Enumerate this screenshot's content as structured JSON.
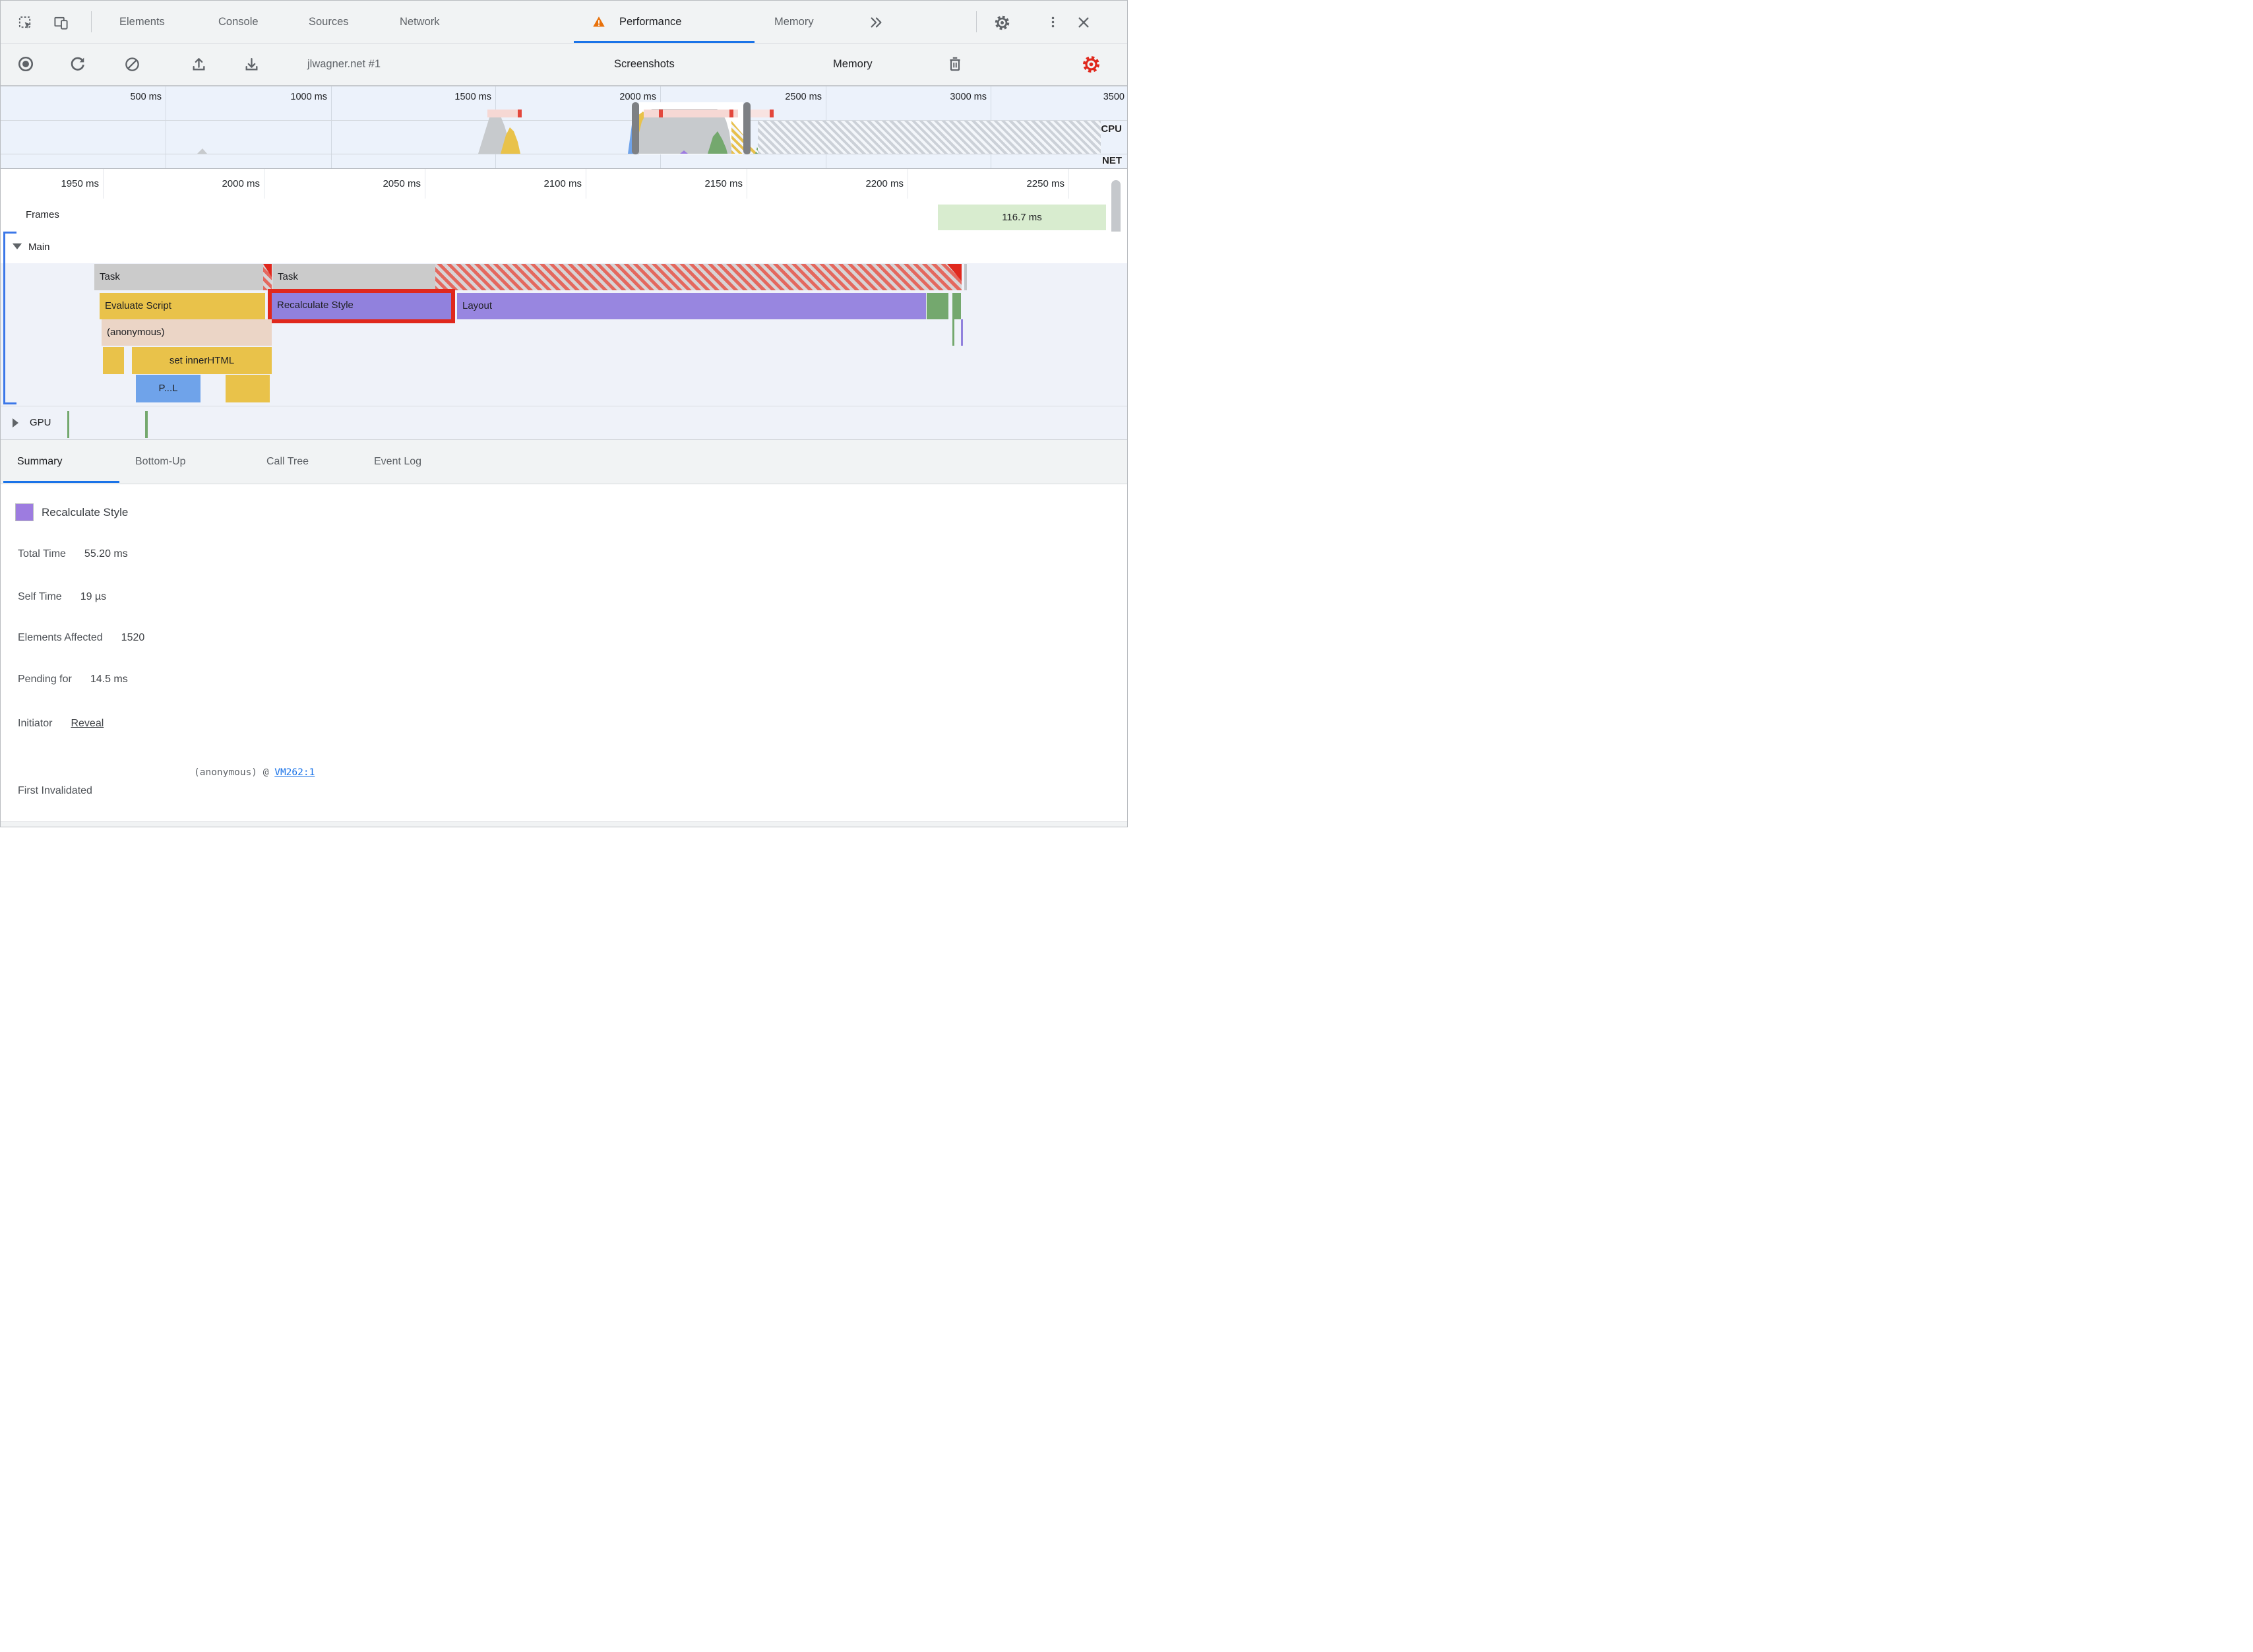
{
  "tabs": {
    "elements": "Elements",
    "console": "Console",
    "sources": "Sources",
    "network": "Network",
    "performance": "Performance",
    "memory": "Memory"
  },
  "toolbar": {
    "session": "jlwagner.net #1",
    "screenshots": "Screenshots",
    "memory": "Memory"
  },
  "overview": {
    "tick_500": "500 ms",
    "tick_1000": "1000 ms",
    "tick_1500": "1500 ms",
    "tick_2000": "2000 ms",
    "tick_2500": "2500 ms",
    "tick_3000": "3000 ms",
    "tick_3500": "3500",
    "cpu": "CPU",
    "net": "NET"
  },
  "ruler": {
    "tick_1950": "1950 ms",
    "tick_2000": "2000 ms",
    "tick_2050": "2050 ms",
    "tick_2100": "2100 ms",
    "tick_2150": "2150 ms",
    "tick_2200": "2200 ms",
    "tick_2250": "2250 ms"
  },
  "frames": {
    "label": "Frames",
    "frame_duration": "116.7 ms"
  },
  "main": {
    "label": "Main",
    "task1": "Task",
    "task2": "Task",
    "evaluate_script": "Evaluate Script",
    "recalculate_style": "Recalculate Style",
    "layout": "Layout",
    "anonymous": "(anonymous)",
    "set_inner_html": "set innerHTML",
    "parse_html": "P...L"
  },
  "gpu": {
    "label": "GPU"
  },
  "bottom_tabs": {
    "summary": "Summary",
    "bottom_up": "Bottom-Up",
    "call_tree": "Call Tree",
    "event_log": "Event Log"
  },
  "summary": {
    "title": "Recalculate Style",
    "total_time_label": "Total Time",
    "total_time": "55.20 ms",
    "self_time_label": "Self Time",
    "self_time": "19 µs",
    "elements_affected_label": "Elements Affected",
    "elements_affected": "1520",
    "pending_for_label": "Pending for",
    "pending_for": "14.5 ms",
    "initiator_label": "Initiator",
    "initiator_link": "Reveal",
    "first_invalidated_label": "First Invalidated",
    "first_invalidated_text": "(anonymous) @ ",
    "first_invalidated_link": "VM262:1"
  },
  "colors": {
    "accent_blue": "#1a73e8",
    "scripting_yellow": "#e9c24a",
    "rendering_purple": "#9181dd",
    "painting_green": "#74a86e",
    "task_gray": "#cbcbcb",
    "anonymous_peach": "#ebd5c6",
    "parse_blue": "#6fa3ea",
    "highlight_red": "#e0281d",
    "long_task_pink": "#f6d8d4",
    "frame_badge_green": "#d8eccf",
    "warning_orange": "#e8710a"
  }
}
